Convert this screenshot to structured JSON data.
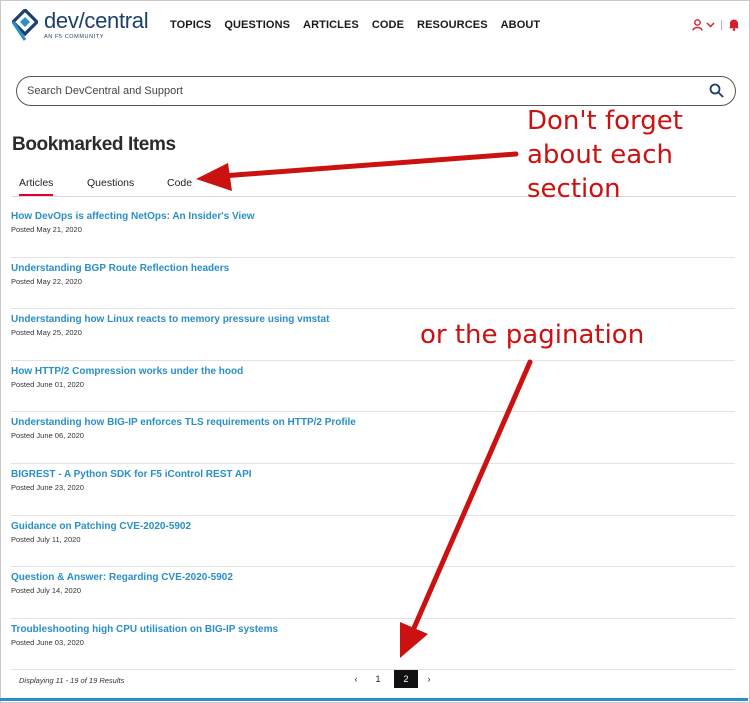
{
  "header": {
    "brand": "dev/central",
    "brand_subtitle": "AN F5 COMMUNITY",
    "nav": [
      "TOPICS",
      "QUESTIONS",
      "ARTICLES",
      "CODE",
      "RESOURCES",
      "ABOUT"
    ],
    "icons": [
      "user-icon",
      "chevron-down-icon",
      "bell-icon"
    ],
    "accent_color": "#d4202d"
  },
  "search": {
    "placeholder": "Search DevCentral and Support"
  },
  "page": {
    "title": "Bookmarked Items",
    "tabs": [
      {
        "label": "Articles",
        "active": true
      },
      {
        "label": "Questions",
        "active": false
      },
      {
        "label": "Code",
        "active": false
      }
    ]
  },
  "items": [
    {
      "title": "How DevOps is affecting NetOps: An Insider's View",
      "date": "Posted May 21, 2020"
    },
    {
      "title": "Understanding BGP Route Reflection headers",
      "date": "Posted May 22, 2020"
    },
    {
      "title": "Understanding how Linux reacts to memory pressure using vmstat",
      "date": "Posted May 25, 2020"
    },
    {
      "title": "How HTTP/2 Compression works under the hood",
      "date": "Posted June 01, 2020"
    },
    {
      "title": "Understanding how BIG-IP enforces TLS requirements on HTTP/2 Profile",
      "date": "Posted June 06, 2020"
    },
    {
      "title": "BIGREST - A Python SDK for F5 iControl REST API",
      "date": "Posted June 23, 2020"
    },
    {
      "title": "Guidance on Patching CVE-2020-5902",
      "date": "Posted July 11, 2020"
    },
    {
      "title": "Question & Answer: Regarding CVE-2020-5902",
      "date": "Posted July 14, 2020"
    },
    {
      "title": "Troubleshooting high CPU utilisation on BIG-IP systems",
      "date": "Posted June 03, 2020"
    }
  ],
  "pagination": {
    "results_text": "Displaying 11 - 19 of 19 Results",
    "prev": "‹",
    "pages": [
      "1",
      "2"
    ],
    "current_page": "2",
    "next": "›"
  },
  "annotations": {
    "note1_lines": [
      "Don't forget",
      "about each",
      "section"
    ],
    "note2": "or the pagination",
    "color": "#cc1111"
  },
  "link_color": "#2a8fc6"
}
